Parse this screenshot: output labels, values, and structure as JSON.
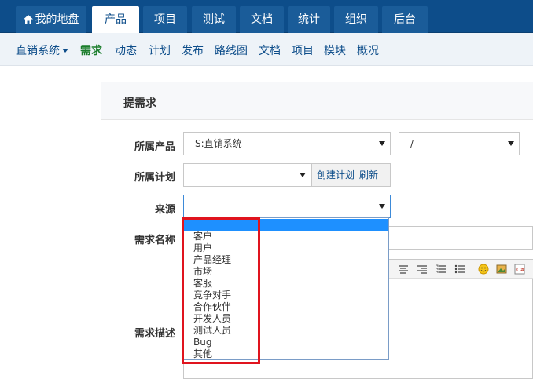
{
  "topnav": {
    "tabs": [
      {
        "label": "我的地盘",
        "icon": "home-icon"
      },
      {
        "label": "产品",
        "active": true
      },
      {
        "label": "项目"
      },
      {
        "label": "测试"
      },
      {
        "label": "文档"
      },
      {
        "label": "统计"
      },
      {
        "label": "组织"
      },
      {
        "label": "后台"
      }
    ]
  },
  "subnav": {
    "product_switcher": "直销系统",
    "items": [
      "需求",
      "动态",
      "计划",
      "发布",
      "路线图",
      "文档",
      "项目",
      "模块",
      "概况"
    ]
  },
  "form": {
    "title": "提需求",
    "product_label": "所属产品",
    "product_value": "S:直销系统",
    "branch_value": "/",
    "plan_label": "所属计划",
    "plan_value": "",
    "create_plan_link": "创建计划",
    "refresh_link": "刷新",
    "source_label": "来源",
    "source_value": "",
    "name_label": "需求名称",
    "desc_label": "需求描述"
  },
  "source_dropdown": {
    "options": [
      "",
      "客户",
      "用户",
      "产品经理",
      "市场",
      "客服",
      "竞争对手",
      "合作伙伴",
      "开发人员",
      "测试人员",
      "Bug",
      "其他"
    ],
    "selected_index": 0
  },
  "colors": {
    "nav_bg": "#0d4d8a",
    "accent_green": "#1a7d2b",
    "highlight_red": "#e0141e",
    "selected_option": "#1e90ff"
  }
}
